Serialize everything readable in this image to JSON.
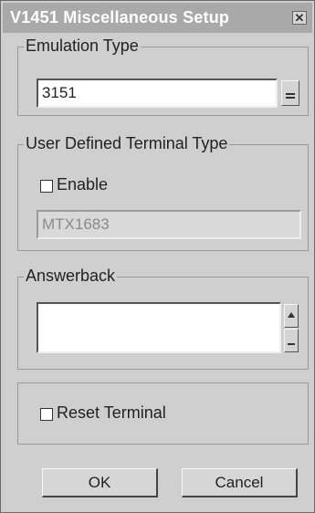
{
  "window": {
    "title": "V1451 Miscellaneous Setup",
    "close_glyph": "✕"
  },
  "emulation": {
    "legend": "Emulation Type",
    "selected": "3151"
  },
  "user_defined": {
    "legend": "User Defined Terminal Type",
    "enable_label": "Enable",
    "enable_checked": false,
    "terminal_value": "MTX1683"
  },
  "answerback": {
    "legend": "Answerback",
    "value": ""
  },
  "reset": {
    "label": "Reset Terminal",
    "checked": false
  },
  "buttons": {
    "ok": "OK",
    "cancel": "Cancel"
  },
  "icons": {
    "dropdown": "dropdown-arrow-icon",
    "scroll_up": "scroll-up-icon",
    "scroll_down": "scroll-down-icon"
  }
}
